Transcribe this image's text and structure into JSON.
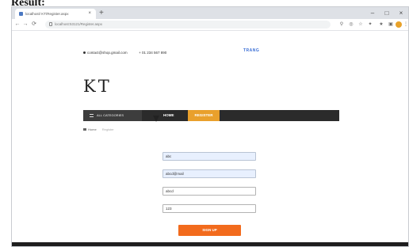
{
  "caption": "Result:",
  "browser": {
    "tab_title": "localhost/ KT/Register.aspx",
    "tab_close": "×",
    "new_tab": "+",
    "window_controls": [
      "–",
      "□",
      "×"
    ],
    "url": "localhost:53121/Register.aspx",
    "nav_buttons": [
      "←",
      "→",
      "⟳"
    ]
  },
  "site": {
    "contact_email": "contact@shop.gmail.com",
    "contact_phone": "+ 01 234 567 890",
    "top_link": "TRANG",
    "logo": "KT",
    "category_label": "ALL CATEGORIES",
    "category_caret": "▾",
    "nav_home": "HOME",
    "nav_active": "REGISTER",
    "breadcrumb_home": "Home",
    "breadcrumb_current": "Register"
  },
  "form": {
    "fields": [
      {
        "value": "abc",
        "state": "filled"
      },
      {
        "value": "abcd@mail",
        "state": "filled"
      },
      {
        "value": "abcd",
        "state": "empty"
      },
      {
        "value": "123",
        "state": "empty"
      }
    ],
    "submit_label": "SIGN UP"
  },
  "colors": {
    "accent": "#e9a02c",
    "submit": "#f26b1d",
    "navbar": "#2b2b2b"
  }
}
